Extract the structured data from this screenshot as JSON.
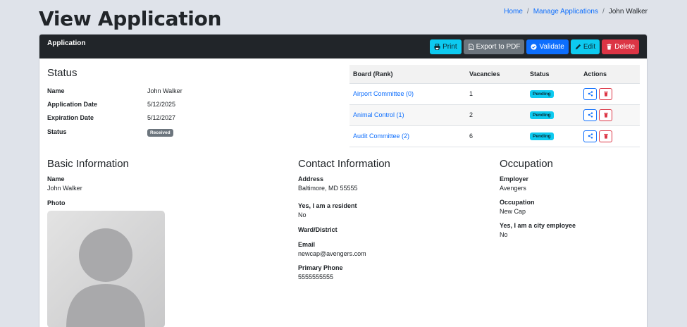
{
  "page": {
    "title": "View Application",
    "breadcrumb": [
      {
        "label": "Home"
      },
      {
        "label": "Manage Applications"
      },
      {
        "label": "John Walker"
      }
    ]
  },
  "card": {
    "title": "Application",
    "toolbar": {
      "print": "Print",
      "export_pdf": "Export to PDF",
      "validate": "Validate",
      "edit": "Edit",
      "delete": "Delete"
    }
  },
  "status": {
    "heading": "Status",
    "rows": [
      {
        "label": "Name",
        "value": "John Walker"
      },
      {
        "label": "Application Date",
        "value": "5/12/2025"
      },
      {
        "label": "Expiration Date",
        "value": "5/12/2027"
      },
      {
        "label": "Status",
        "value": "Received"
      }
    ]
  },
  "boards": {
    "headers": [
      "Board (Rank)",
      "Vacancies",
      "Status",
      "Actions"
    ],
    "rows": [
      {
        "board": "Airport Committee (0)",
        "vacancies": "1",
        "status": "Pending"
      },
      {
        "board": "Animal Control (1)",
        "vacancies": "2",
        "status": "Pending"
      },
      {
        "board": "Audit Committee (2)",
        "vacancies": "6",
        "status": "Pending"
      }
    ]
  },
  "basic": {
    "heading": "Basic Information",
    "name_label": "Name",
    "name_value": "John Walker",
    "photo_label": "Photo"
  },
  "contact": {
    "heading": "Contact Information",
    "address_label": "Address",
    "address_value": "Baltimore, MD 55555",
    "resident_label": "Yes, I am a resident",
    "resident_value": "No",
    "ward_label": "Ward/District",
    "email_label": "Email",
    "email_value": "newcap@avengers.com",
    "phone_label": "Primary Phone",
    "phone_value": "5555555555"
  },
  "occupation": {
    "heading": "Occupation",
    "employer_label": "Employer",
    "employer_value": "Avengers",
    "occupation_label": "Occupation",
    "occupation_value": "New Cap",
    "city_employee_label": "Yes, I am a city employee",
    "city_employee_value": "No"
  },
  "colors": {
    "primary": "#0d6efd",
    "info": "#0dcaf0",
    "secondary": "#6c757d",
    "danger": "#dc3545",
    "dark": "#212529"
  }
}
